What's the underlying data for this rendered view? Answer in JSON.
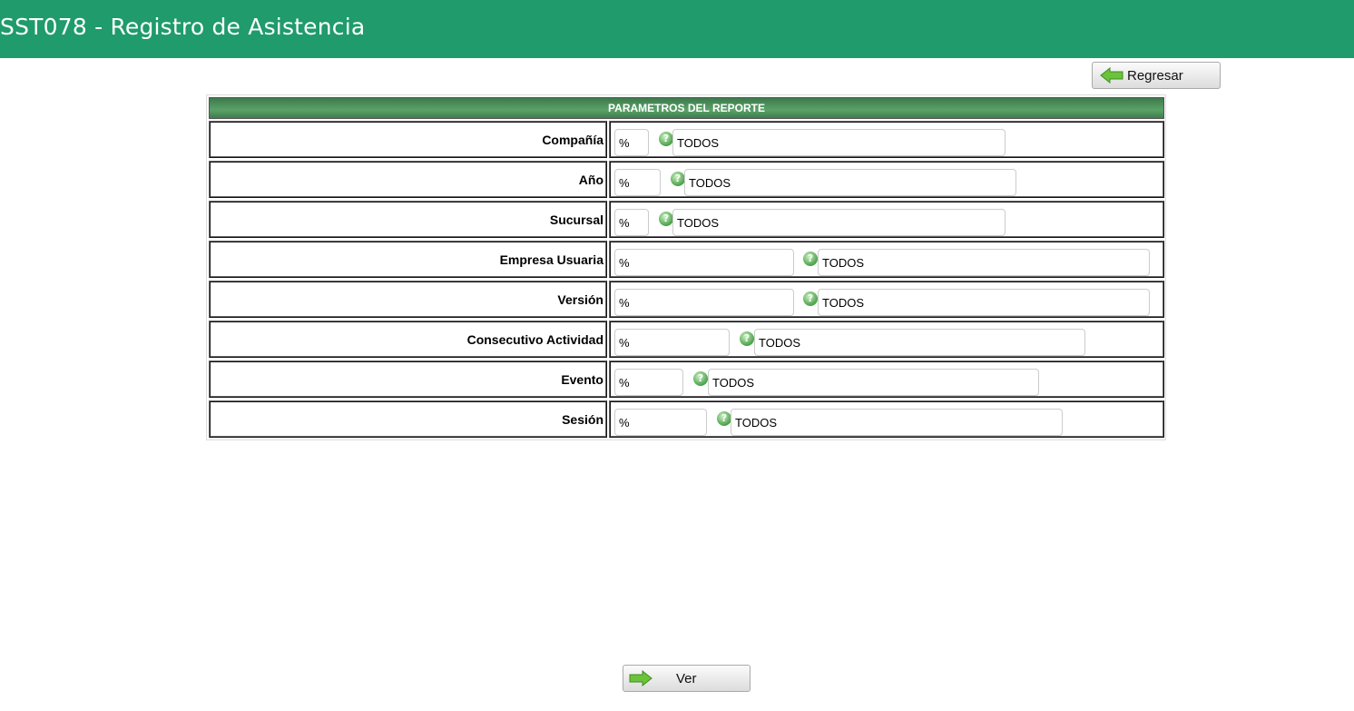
{
  "header": {
    "title": "SST078 - Registro de Asistencia"
  },
  "buttons": {
    "back": "Regresar",
    "view": "Ver"
  },
  "panel": {
    "title": "PARAMETROS DEL REPORTE"
  },
  "colors": {
    "topbar": "#1f9b6c",
    "header": "#4a8d5a",
    "icon": "#4aa14a"
  },
  "fields": [
    {
      "label": "Compañía",
      "code": "%",
      "desc": "TODOS"
    },
    {
      "label": "Año",
      "code": "%",
      "desc": "TODOS"
    },
    {
      "label": "Sucursal",
      "code": "%",
      "desc": "TODOS"
    },
    {
      "label": "Empresa Usuaria",
      "code": "%",
      "desc": "TODOS"
    },
    {
      "label": "Versión",
      "code": "%",
      "desc": "TODOS"
    },
    {
      "label": "Consecutivo Actividad",
      "code": "%",
      "desc": "TODOS"
    },
    {
      "label": "Evento",
      "code": "%",
      "desc": "TODOS"
    },
    {
      "label": "Sesión",
      "code": "%",
      "desc": "TODOS"
    }
  ]
}
